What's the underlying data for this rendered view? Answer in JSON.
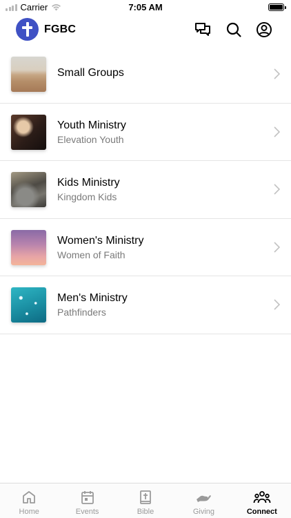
{
  "status_bar": {
    "carrier": "Carrier",
    "time": "7:05 AM"
  },
  "header": {
    "title": "FGBC",
    "logo_icon": "cross-icon",
    "actions": [
      "chat-icon",
      "search-icon",
      "profile-icon"
    ]
  },
  "groups": [
    {
      "title": "Small Groups",
      "subtitle": "",
      "thumb": "desert"
    },
    {
      "title": "Youth Ministry",
      "subtitle": "Elevation Youth",
      "thumb": "youth"
    },
    {
      "title": "Kids Ministry",
      "subtitle": "Kingdom Kids",
      "thumb": "kids"
    },
    {
      "title": "Women's Ministry",
      "subtitle": "Women of Faith",
      "thumb": "women"
    },
    {
      "title": "Men's Ministry",
      "subtitle": "Pathfinders",
      "thumb": "men"
    }
  ],
  "tabs": [
    {
      "label": "Home",
      "icon": "home-icon",
      "active": false
    },
    {
      "label": "Events",
      "icon": "calendar-icon",
      "active": false
    },
    {
      "label": "Bible",
      "icon": "bible-icon",
      "active": false
    },
    {
      "label": "Giving",
      "icon": "giving-hand-icon",
      "active": false
    },
    {
      "label": "Connect",
      "icon": "people-icon",
      "active": true
    }
  ],
  "colors": {
    "accent": "#3f51c4",
    "separator": "#e4e4e4",
    "subtitle": "#7a7a7a",
    "tab_inactive": "#9a9a9a"
  }
}
